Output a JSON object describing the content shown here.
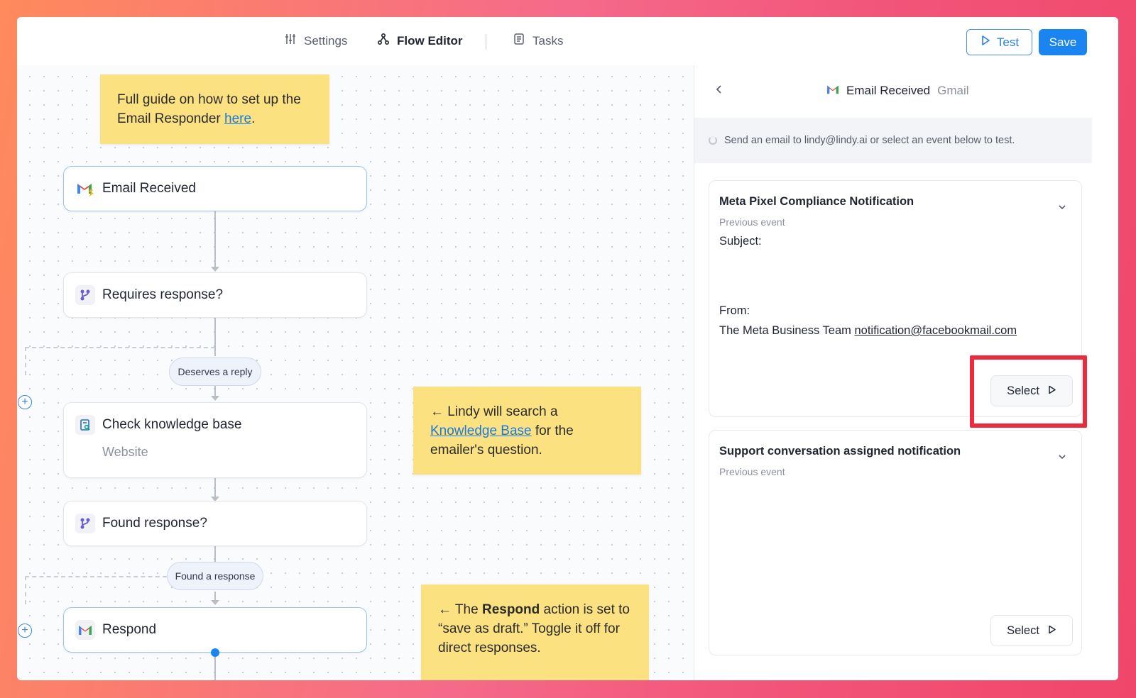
{
  "topbar": {
    "tabs": [
      {
        "label": "Settings",
        "icon": "sliders-icon"
      },
      {
        "label": "Flow Editor",
        "icon": "flow-icon"
      },
      {
        "label": "Tasks",
        "icon": "tasks-icon"
      }
    ],
    "test_label": "Test",
    "save_label": "Save"
  },
  "canvas": {
    "guide_note": {
      "prefix": "Full guide on how to set up the Email Responder ",
      "link": "here",
      "suffix": "."
    },
    "nodes": [
      {
        "title": "Email Received",
        "icon": "gmail-trigger-icon"
      },
      {
        "title": "Requires response?",
        "icon": "branch-icon"
      },
      {
        "title": "Check knowledge base",
        "subtitle": "Website",
        "icon": "knowledge-base-icon"
      },
      {
        "title": "Found response?",
        "icon": "branch-icon"
      },
      {
        "title": "Respond",
        "icon": "gmail-icon"
      }
    ],
    "pills": [
      "Deserves a reply",
      "Found a response"
    ],
    "kb_note": {
      "arrow": "←",
      "prefix": " Lindy will search a ",
      "link": "Knowledge Base",
      "suffix": " for the emailer's question."
    },
    "respond_note": {
      "arrow": "←",
      "prefix": " The ",
      "bold": "Respond",
      "suffix": " action is set to “save as draft.” Toggle it off for direct responses."
    }
  },
  "panel": {
    "title": "Email Received",
    "subtitle": "Gmail",
    "info": "Send an email to lindy@lindy.ai or select an event below to test.",
    "events": [
      {
        "title": "Meta Pixel Compliance Notification",
        "sub": "Previous event",
        "subject_label": "Subject:",
        "from_label": "From:",
        "from_name": "The Meta Business Team",
        "from_email": "notification@facebookmail.com",
        "select_label": "Select"
      },
      {
        "title": "Support conversation assigned notification",
        "sub": "Previous event",
        "select_label": "Select"
      }
    ]
  },
  "colors": {
    "accent": "#1a84f0",
    "note": "#fbe17f",
    "highlight": "#ee2a3f"
  }
}
